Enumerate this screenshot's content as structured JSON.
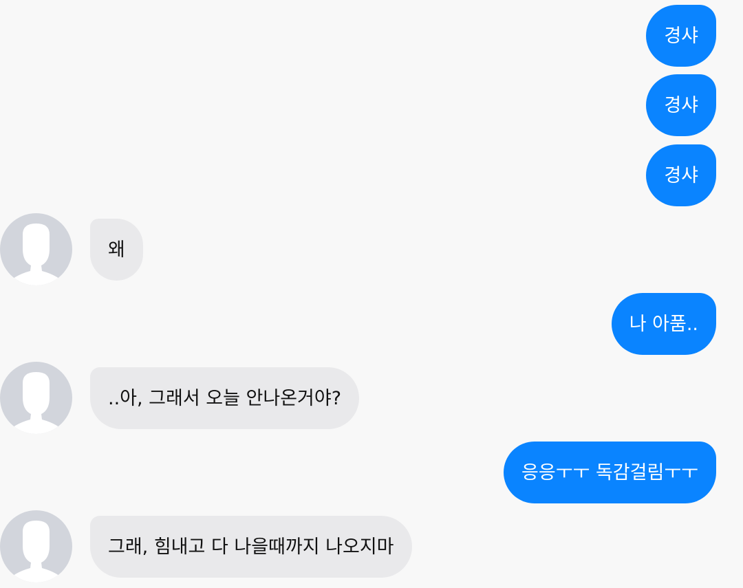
{
  "conversation": {
    "messages": [
      {
        "sender": "me",
        "text": "경샤"
      },
      {
        "sender": "me",
        "text": "경샤"
      },
      {
        "sender": "me",
        "text": "경샤"
      },
      {
        "sender": "other",
        "text": "왜"
      },
      {
        "sender": "me",
        "text": "나 아품.."
      },
      {
        "sender": "other",
        "text": "..아, 그래서 오늘 안나온거야?"
      },
      {
        "sender": "me",
        "text": "응응ㅜㅜ 독감걸림ㅜㅜ"
      },
      {
        "sender": "other",
        "text": "그래, 힘내고 다 나을때까지 나오지마"
      }
    ]
  },
  "colors": {
    "outgoing_bubble": "#0a84ff",
    "incoming_bubble": "#e9e9eb",
    "background": "#f8f8f8",
    "avatar_bg": "#d2d5dc"
  },
  "icons": {
    "avatar": "default-user-silhouette-icon"
  }
}
